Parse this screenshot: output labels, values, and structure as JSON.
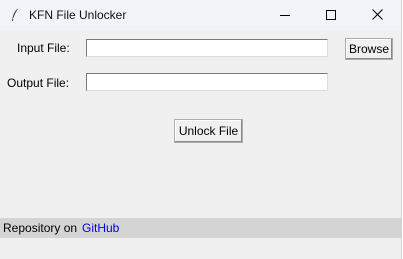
{
  "window": {
    "title": "KFN File Unlocker",
    "icon": "feather-icon",
    "controls": {
      "minimize_icon": "minimize-icon",
      "maximize_icon": "maximize-icon",
      "close_icon": "close-icon"
    }
  },
  "form": {
    "input_label": "Input File:",
    "input_value": "",
    "browse_label": "Browse",
    "output_label": "Output File:",
    "output_value": "",
    "unlock_label": "Unlock File"
  },
  "footer": {
    "text": "Repository on",
    "link_label": "GitHub",
    "link_color": "#0000ee"
  }
}
